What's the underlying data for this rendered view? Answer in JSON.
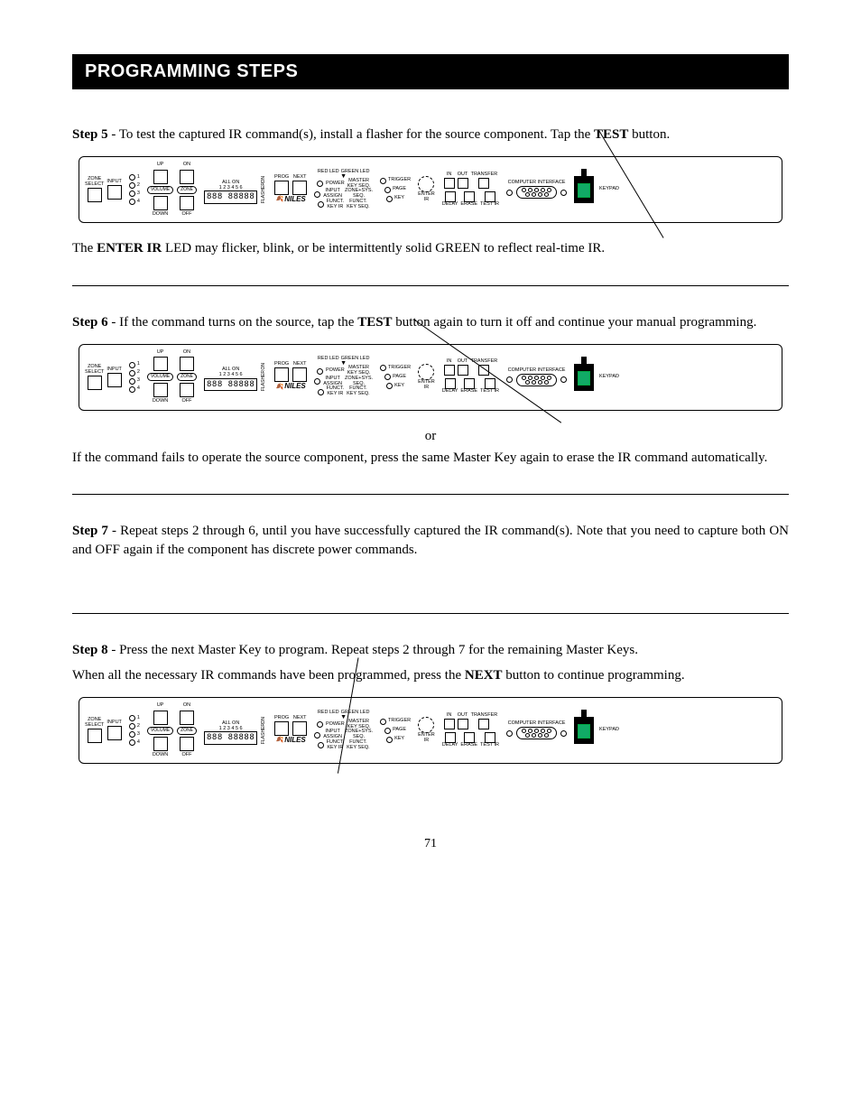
{
  "title": "PROGRAMMING STEPS",
  "page_number": "71",
  "steps": {
    "s5": {
      "label": "Step 5",
      "text_a": " - To test the captured IR command(s), install a flasher for the source component. Tap the ",
      "bold": "TEST",
      "text_b": " button."
    },
    "s5_after_a": "The ",
    "s5_after_bold": "ENTER IR",
    "s5_after_b": " LED may flicker, blink, or be intermittently solid GREEN to reflect real-time IR.",
    "s6": {
      "label": "Step 6",
      "text_a": " - If the command turns on the source, tap the ",
      "bold": "TEST",
      "text_b": " button again to turn it off and continue your manual programming."
    },
    "or": "or",
    "s6_after": "If the command fails to operate the source component, press the same Master Key again to erase the IR command automatically.",
    "s7": {
      "label": "Step 7",
      "text": " - Repeat steps 2 through 6, until you have successfully captured the IR command(s). Note that you need to capture both ON and OFF again if the component has discrete power commands."
    },
    "s8": {
      "label": "Step 8",
      "text": " - Press the next Master Key to program. Repeat steps 2 through 7 for the remaining Master Keys."
    },
    "s8_after_a": "When all the necessary IR commands have been programmed, press the ",
    "s8_after_bold": "NEXT",
    "s8_after_b": " button to continue programming."
  },
  "panel": {
    "zone_select": "ZONE\nSELECT",
    "input": "INPUT",
    "nums": [
      "1",
      "2",
      "3",
      "4"
    ],
    "up": "UP",
    "down": "DOWN",
    "on": "ON",
    "off": "OFF",
    "volume": "VOLUME",
    "zone": "ZONE",
    "all_on": "ALL ON",
    "one_six": "1 2 3 4 5 6",
    "on2": "ON",
    "flasher": "FLASHER",
    "digits": "888 88888",
    "prog": "PROG",
    "next": "NEXT",
    "brand": "NILES",
    "red_led": "RED LED",
    "green_led": "GREEN LED",
    "power": "POWER",
    "master_key_seq": "MASTER\nKEY SEQ.",
    "input_assign": "INPUT\nASSIGN",
    "zone_sys_seq": "ZONE+SYS.\nSEQ.",
    "funct_key_ir": "FUNCT.\nKEY IR",
    "funct_key_seq": "FUNCT.\nKEY SEQ.",
    "trigger": "TRIGGER",
    "page": "PAGE",
    "key": "KEY",
    "enter_ir": "ENTER\nIR",
    "in": "IN",
    "out": "OUT",
    "transfer": "TRANSFER",
    "delay": "DELAY",
    "erase": "ERASE",
    "test_ir": "TEST IR",
    "computer_interface": "COMPUTER INTERFACE",
    "keypad": "KEYPAD"
  }
}
